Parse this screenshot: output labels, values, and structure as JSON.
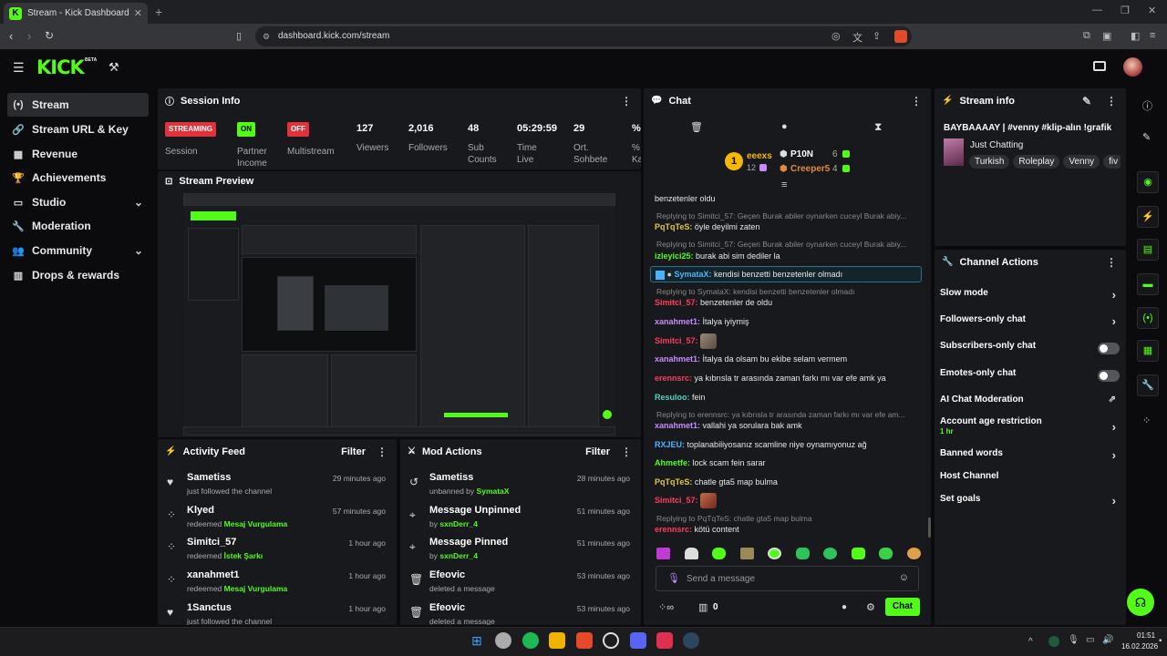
{
  "browser": {
    "tab_title": "Stream - Kick Dashboard",
    "url": "dashboard.kick.com/stream"
  },
  "header": {
    "logo": "KICK",
    "beta": "BETA"
  },
  "sidebar": {
    "items": [
      {
        "label": "Stream",
        "icon": "broadcast-icon"
      },
      {
        "label": "Stream URL & Key",
        "icon": "link-icon"
      },
      {
        "label": "Revenue",
        "icon": "money-icon"
      },
      {
        "label": "Achievements",
        "icon": "trophy-icon"
      },
      {
        "label": "Studio",
        "icon": "studio-icon"
      },
      {
        "label": "Moderation",
        "icon": "wrench-icon"
      },
      {
        "label": "Community",
        "icon": "people-icon"
      },
      {
        "label": "Drops & rewards",
        "icon": "gift-icon"
      }
    ]
  },
  "session": {
    "title": "Session Info",
    "status_badge": "STREAMING",
    "status_label": "Session",
    "partner_badge": "ON",
    "partner_label_1": "Partner",
    "partner_label_2": "Income",
    "multistream_badge": "OFF",
    "multistream_label": "Multistream",
    "stats": [
      {
        "value": "127",
        "label_1": "Viewers",
        "label_2": ""
      },
      {
        "value": "2,016",
        "label_1": "Followers",
        "label_2": ""
      },
      {
        "value": "48",
        "label_1": "Sub",
        "label_2": "Counts"
      },
      {
        "value": "05:29:59",
        "label_1": "Time",
        "label_2": "Live"
      },
      {
        "value": "29",
        "label_1": "Ort.",
        "label_2": "Sohbete"
      },
      {
        "value": "%",
        "label_1": "%",
        "label_2": "Ka"
      }
    ]
  },
  "preview": {
    "title": "Stream Preview"
  },
  "activity": {
    "title": "Activity Feed",
    "filter": "Filter",
    "rows": [
      {
        "name": "Sametiss",
        "sub": "just followed the channel",
        "highlight": "",
        "time": "29 minutes ago"
      },
      {
        "name": "Klyed",
        "sub": "redeemed",
        "highlight": "Mesaj Vurgulama",
        "time": "57 minutes ago"
      },
      {
        "name": "Simitci_57",
        "sub": "redeemed",
        "highlight": "İstek Şarkı",
        "time": "1 hour ago"
      },
      {
        "name": "xanahmet1",
        "sub": "redeemed",
        "highlight": "Mesaj Vurgulama",
        "time": "1 hour ago"
      },
      {
        "name": "1Sanctus",
        "sub": "just followed the channel",
        "highlight": "",
        "time": "1 hour ago"
      }
    ]
  },
  "mod": {
    "title": "Mod Actions",
    "filter": "Filter",
    "rows": [
      {
        "name": "Sametiss",
        "sub": "unbanned by",
        "highlight": "SymataX",
        "time": "28 minutes ago"
      },
      {
        "name": "Message Unpinned",
        "sub": "by",
        "highlight": "sxnDerr_4",
        "time": "51 minutes ago"
      },
      {
        "name": "Message Pinned",
        "sub": "by",
        "highlight": "sxnDerr_4",
        "time": "51 minutes ago"
      },
      {
        "name": "Efeovic",
        "sub": "deleted a message",
        "highlight": "",
        "time": "53 minutes ago"
      },
      {
        "name": "Efeovic",
        "sub": "deleted a message",
        "highlight": "",
        "time": "53 minutes ago"
      }
    ]
  },
  "chat": {
    "title": "Chat",
    "top_gifter": {
      "name": "eeexs",
      "count": "12",
      "rank": "1"
    },
    "leaders": [
      {
        "name": "P10N",
        "count": "6"
      },
      {
        "name": "Creeper5",
        "count": "4"
      }
    ],
    "messages": [
      {
        "user": "",
        "text": "benzetenler oldu",
        "color": "#e8e8e8"
      },
      {
        "reply": "Replying to Simitci_57: Geçen Burak abiler oynarken cuceyl Burak abiy..."
      },
      {
        "user": "PqTqTeS:",
        "text": "öyle deyilmi zaten",
        "color": "#e0c84a"
      },
      {
        "reply": "Replying to Simitci_57: Geçen Burak abiler oynarken cuceyl Burak abiy..."
      },
      {
        "user": "izleyici25:",
        "text": "burak abi sim dediler la",
        "color": "#53fc18"
      },
      {
        "user": "SymataX:",
        "text": "kendisi benzetti benzetenler olmadı",
        "color": "#4ab3ff"
      },
      {
        "reply": "Replying to SymataX: kendisi benzetti benzetenler olmadı"
      },
      {
        "user": "Simitci_57:",
        "text": "benzetenler de oldu",
        "color": "#ff3b5c"
      },
      {
        "user": "xanahmet1:",
        "text": "İtalya iyiymiş",
        "color": "#c78bff"
      },
      {
        "user": "Simitci_57:",
        "text": "",
        "color": "#ff3b5c"
      },
      {
        "user": "xanahmet1:",
        "text": "İtalya da olsam bu ekibe selam vermem",
        "color": "#c78bff"
      },
      {
        "user": "erennsrc:",
        "text": "ya kıbrısla tr arasında zaman farkı mı var efe amk ya",
        "color": "#ff3b5c"
      },
      {
        "user": "Resuloo:",
        "text": "fein",
        "color": "#4fd1c5"
      },
      {
        "reply": "Replying to erennsrc: ya kıbrısla tr arasında zaman farkı mı var efe am..."
      },
      {
        "user": "xanahmet1:",
        "text": "vallahi ya sorulara bak amk",
        "color": "#c78bff"
      },
      {
        "user": "RXJEU:",
        "text": "toplanabiliyosanız scamline niye oynamıyonuz ağ",
        "color": "#4ab3ff"
      },
      {
        "user": "Ahmetfe:",
        "text": "lock scam fein sarar",
        "color": "#53fc18"
      },
      {
        "user": "PqTqTeS:",
        "text": "chatle gta5 map bulma",
        "color": "#e0c84a"
      },
      {
        "user": "Simitci_57:",
        "text": "",
        "color": "#ff3b5c"
      },
      {
        "reply": "Replying to PqTqTeS: chatle gta5 map bulma"
      },
      {
        "user": "erennsrc:",
        "text": "kötü content",
        "color": "#ff3b5c"
      }
    ],
    "input_placeholder": "Send a message",
    "points": "0",
    "send_label": "Chat"
  },
  "stream_info": {
    "title": "Stream info",
    "stream_title": "BAYBAAAAY | #venny #klip-alın !grafik",
    "category": "Just Chatting",
    "tags": [
      "Turkish",
      "Roleplay",
      "Venny",
      "fiv"
    ]
  },
  "channel_actions": {
    "title": "Channel Actions",
    "items": [
      {
        "label": "Slow mode",
        "sub": ""
      },
      {
        "label": "Followers-only chat",
        "sub": ""
      },
      {
        "label": "Subscribers-only chat",
        "sub": ""
      },
      {
        "label": "Emotes-only chat",
        "sub": ""
      },
      {
        "label": "AI Chat Moderation",
        "sub": ""
      },
      {
        "label": "Account age restriction",
        "sub": "1 hr"
      },
      {
        "label": "Banned words",
        "sub": ""
      },
      {
        "label": "Host Channel",
        "sub": ""
      },
      {
        "label": "Set goals",
        "sub": ""
      }
    ]
  },
  "taskbar": {
    "time": "01:51",
    "date": "16.02.2026"
  },
  "colors": {
    "accent": "#53fc18",
    "danger": "#e0323a",
    "panel": "#18191c"
  }
}
